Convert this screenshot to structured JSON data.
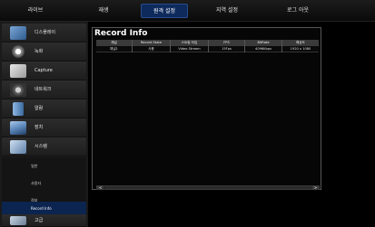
{
  "topnav": {
    "items": [
      {
        "label": "라이브"
      },
      {
        "label": "재생"
      },
      {
        "label": "원격 설정"
      },
      {
        "label": "지역 설정"
      },
      {
        "label": "로그 아웃"
      }
    ],
    "active_index": 2
  },
  "sidebar": {
    "items": [
      {
        "label": "디스플레이",
        "icon": "display-icon"
      },
      {
        "label": "녹화",
        "icon": "record-icon"
      },
      {
        "label": "Capture",
        "icon": "capture-icon"
      },
      {
        "label": "네트워크",
        "icon": "network-icon"
      },
      {
        "label": "알람",
        "icon": "alarm-icon"
      },
      {
        "label": "장치",
        "icon": "device-icon"
      },
      {
        "label": "시스템",
        "icon": "system-icon"
      }
    ],
    "subitems": [
      {
        "label": "일반"
      },
      {
        "label": "사용자"
      },
      {
        "label": "정보"
      },
      {
        "label": "Channel Info"
      },
      {
        "label": "Record Info"
      }
    ],
    "active_subitem": "Record Info",
    "bottom_item": {
      "label": "고급",
      "icon": "advanced-icon"
    }
  },
  "panel": {
    "title": "Record Info",
    "columns": [
      "채널",
      "Record State",
      "스트림 타입",
      "FPS",
      "BitRate",
      "해상도"
    ],
    "rows": [
      [
        "채널1",
        "사용",
        "Video Stream",
        "15Fps",
        "4096Kbps",
        "1920 x 1080"
      ]
    ],
    "scroll_left": "<",
    "scroll_right": ">"
  },
  "colors": {
    "active_nav": "#0e2a5c",
    "active_subitem": "#0c2450",
    "panel_border": "#555555"
  }
}
